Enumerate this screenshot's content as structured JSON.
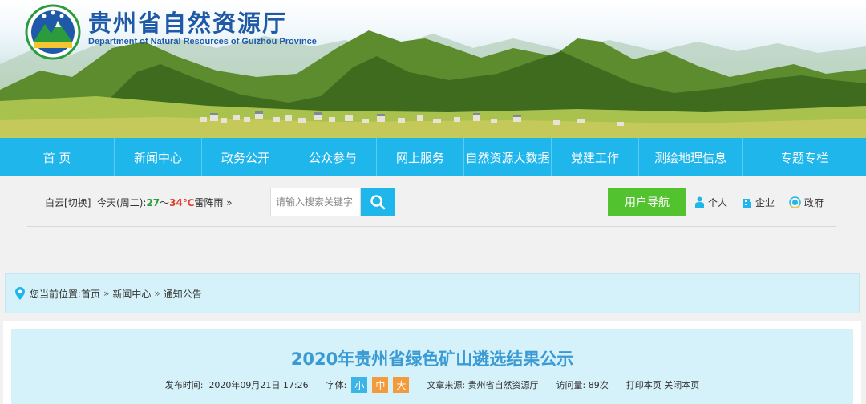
{
  "header": {
    "title": "贵州省自然资源厅",
    "subtitle": "Department of Natural Resources of Guizhou Province"
  },
  "nav": {
    "items": [
      {
        "label": "首  页"
      },
      {
        "label": "新闻中心"
      },
      {
        "label": "政务公开"
      },
      {
        "label": "公众参与"
      },
      {
        "label": "网上服务"
      },
      {
        "label": "自然资源大数据"
      },
      {
        "label": "党建工作"
      },
      {
        "label": "测绘地理信息"
      },
      {
        "label": "专题专栏"
      }
    ]
  },
  "weather": {
    "city": "白云",
    "switch_label": "[切换]",
    "day": "今天(周二):",
    "low": "27",
    "tilde": "～",
    "high": "34℃",
    "condition": "雷阵雨",
    "more": "»"
  },
  "search": {
    "placeholder": "请输入搜索关键字",
    "icon": "search-icon"
  },
  "user_guide": {
    "label": "用户导航",
    "roles": [
      {
        "label": "个人",
        "icon": "person-icon"
      },
      {
        "label": "企业",
        "icon": "building-icon"
      },
      {
        "label": "政府",
        "icon": "emblem-icon"
      }
    ]
  },
  "breadcrumb": {
    "prefix": "您当前位置:",
    "items": [
      "首页",
      "新闻中心",
      "通知公告"
    ],
    "separator": "»"
  },
  "article": {
    "title": "2020年贵州省绿色矿山遴选结果公示",
    "publish_label": "发布时间:",
    "publish_time": "2020年09月21日 17:26",
    "font_label": "字体:",
    "font_small": "小",
    "font_medium": "中",
    "font_large": "大",
    "source_label": "文章来源:",
    "source": "贵州省自然资源厅",
    "views_label": "访问量:",
    "views": "89次",
    "print": "打印本页",
    "close": "关闭本页"
  },
  "colors": {
    "nav_bg": "#1fb6ec",
    "guide_btn": "#52c32e",
    "title_blue": "#3a9ad4",
    "crumb_bg": "#d5f1f9"
  }
}
